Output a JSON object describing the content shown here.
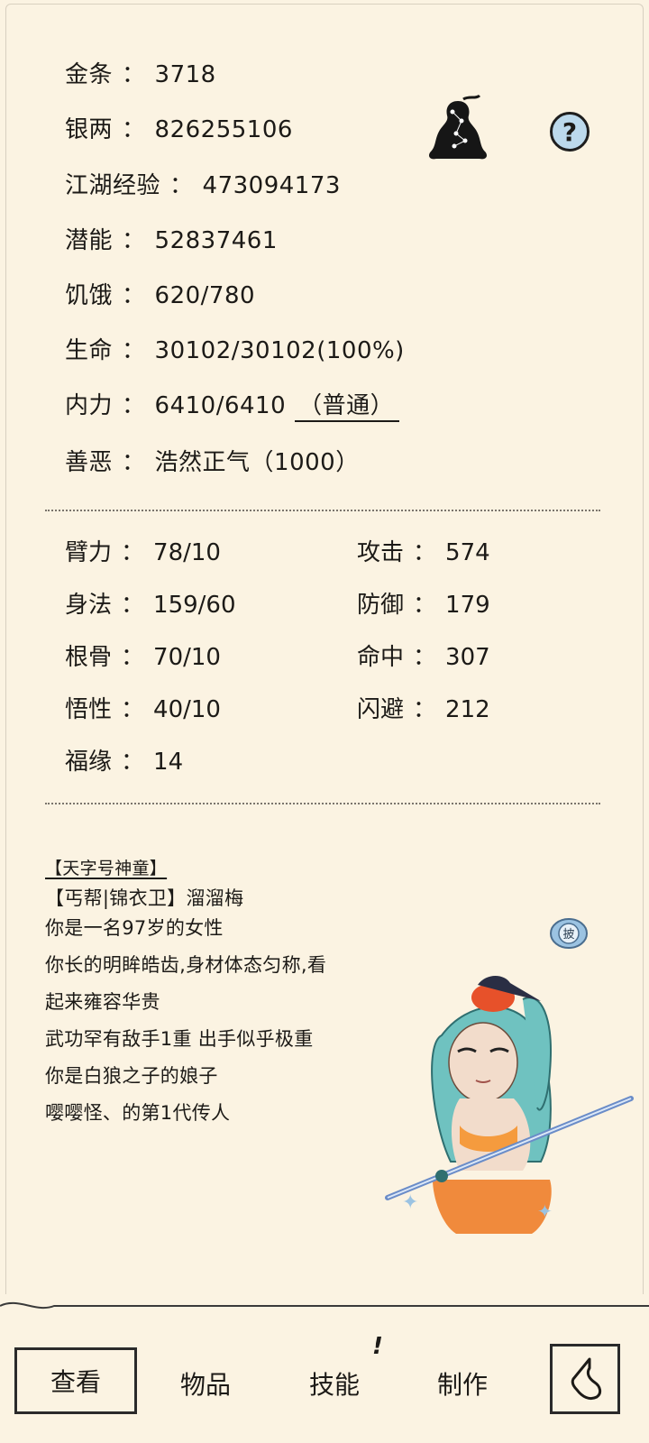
{
  "resources": {
    "gold": {
      "label": "金条",
      "value": "3718"
    },
    "silver": {
      "label": "银两",
      "value": "826255106"
    },
    "exp": {
      "label": "江湖经验",
      "value": "473094173"
    },
    "potential": {
      "label": "潜能",
      "value": "52837461"
    },
    "hunger": {
      "label": "饥饿",
      "value": "620/780"
    },
    "hp": {
      "label": "生命",
      "value": "30102/30102(100%)"
    },
    "neili": {
      "label": "内力",
      "value": "6410/6410",
      "mode": "（普通）"
    },
    "morality": {
      "label": "善恶",
      "value": "浩然正气（1000）"
    }
  },
  "separator": "：",
  "attributes": [
    {
      "label": "臂力",
      "value": "78/10"
    },
    {
      "label": "身法",
      "value": "159/60"
    },
    {
      "label": "根骨",
      "value": "70/10"
    },
    {
      "label": "悟性",
      "value": "40/10"
    },
    {
      "label": "福缘",
      "value": "14"
    }
  ],
  "combat": [
    {
      "label": "攻击",
      "value": "574"
    },
    {
      "label": "防御",
      "value": "179"
    },
    {
      "label": "命中",
      "value": "307"
    },
    {
      "label": "闪避",
      "value": "212"
    }
  ],
  "bio": {
    "title": "【天字号神童】",
    "lines": [
      "【丐帮|锦衣卫】溜溜梅",
      "你是一名97岁的女性",
      "你长的明眸皓齿,身材体态匀称,看",
      "起来雍容华贵",
      "武功罕有敌手1重 出手似乎极重",
      "你是白狼之子的娘子",
      "嘤嘤怪、的第1代传人"
    ]
  },
  "badge_text": "披",
  "help_label": "?",
  "tabs": [
    {
      "label": "查看",
      "active": true
    },
    {
      "label": "物品",
      "active": false
    },
    {
      "label": "技能",
      "active": false,
      "notice": "!"
    },
    {
      "label": "制作",
      "active": false
    }
  ],
  "colors": {
    "background": "#fbf3e2",
    "help_button": "#bcd9ec",
    "hair": "#6fc2c0",
    "skirt": "#f08a3c"
  }
}
